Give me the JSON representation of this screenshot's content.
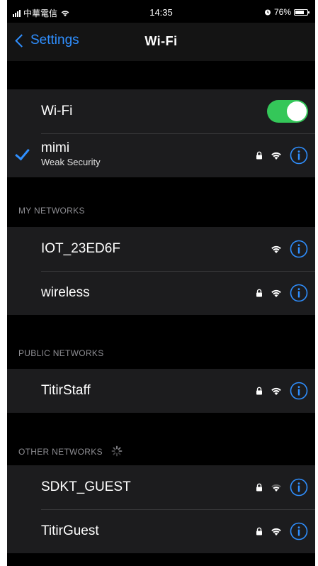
{
  "status_bar": {
    "carrier": "中華電信",
    "time": "14:35",
    "battery": "76%",
    "battery_level": 0.76
  },
  "nav": {
    "back_label": "Settings",
    "title": "Wi-Fi"
  },
  "wifi_toggle": {
    "label": "Wi-Fi",
    "on": true,
    "color": "#34c759"
  },
  "connected": {
    "name": "mimi",
    "subtitle": "Weak Security",
    "locked": true
  },
  "sections": {
    "my_networks": {
      "header": "MY NETWORKS",
      "items": [
        {
          "name": "IOT_23ED6F",
          "locked": false
        },
        {
          "name": "wireless",
          "locked": true
        }
      ]
    },
    "public_networks": {
      "header": "PUBLIC NETWORKS",
      "items": [
        {
          "name": "TitirStaff",
          "locked": true
        }
      ]
    },
    "other_networks": {
      "header": "OTHER NETWORKS",
      "items": [
        {
          "name": "SDKT_GUEST",
          "locked": true
        },
        {
          "name": "TitirGuest",
          "locked": true
        }
      ]
    }
  },
  "icons": {
    "lock": "lock-icon",
    "wifi": "wifi-icon",
    "info": "info-icon",
    "checkmark": "checkmark-icon",
    "spinner": "spinner-icon"
  },
  "colors": {
    "accent": "#2f8fff",
    "background": "#000000",
    "cell": "#1c1c1e"
  }
}
